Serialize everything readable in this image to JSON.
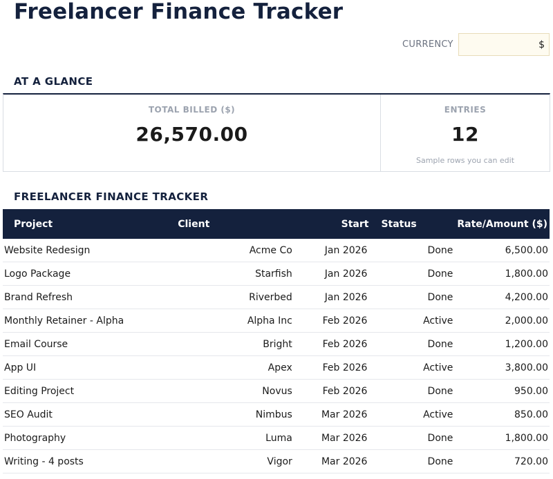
{
  "header": {
    "title": "Freelancer Finance Tracker",
    "currency_label": "CURRENCY",
    "currency_value": "$"
  },
  "glance": {
    "section_title": "AT A GLANCE",
    "total_billed_label": "TOTAL BILLED ($)",
    "total_billed_value": "26,570.00",
    "entries_label": "ENTRIES",
    "entries_value": "12",
    "entries_note": "Sample rows you can edit"
  },
  "tracker": {
    "section_title": "FREELANCER FINANCE TRACKER",
    "columns": [
      "Project",
      "Client",
      "Start",
      "Status",
      "Rate/Amount ($)"
    ],
    "rows": [
      [
        "Website Redesign",
        "Acme Co",
        "Jan 2026",
        "Done",
        "6,500.00"
      ],
      [
        "Logo Package",
        "Starfish",
        "Jan 2026",
        "Done",
        "1,800.00"
      ],
      [
        "Brand Refresh",
        "Riverbed",
        "Jan 2026",
        "Done",
        "4,200.00"
      ],
      [
        "Monthly Retainer - Alpha",
        "Alpha Inc",
        "Feb 2026",
        "Active",
        "2,000.00"
      ],
      [
        "Email Course",
        "Bright",
        "Feb 2026",
        "Done",
        "1,200.00"
      ],
      [
        "App UI",
        "Apex",
        "Feb 2026",
        "Active",
        "3,800.00"
      ],
      [
        "Editing Project",
        "Novus",
        "Feb 2026",
        "Done",
        "950.00"
      ],
      [
        "SEO Audit",
        "Nimbus",
        "Mar 2026",
        "Active",
        "850.00"
      ],
      [
        "Photography",
        "Luma",
        "Mar 2026",
        "Done",
        "1,800.00"
      ],
      [
        "Writing - 4 posts",
        "Vigor",
        "Mar 2026",
        "Done",
        "720.00"
      ]
    ]
  },
  "colors": {
    "navy": "#14213d",
    "muted": "#9ca3af",
    "input_bg": "#fefbf0"
  }
}
